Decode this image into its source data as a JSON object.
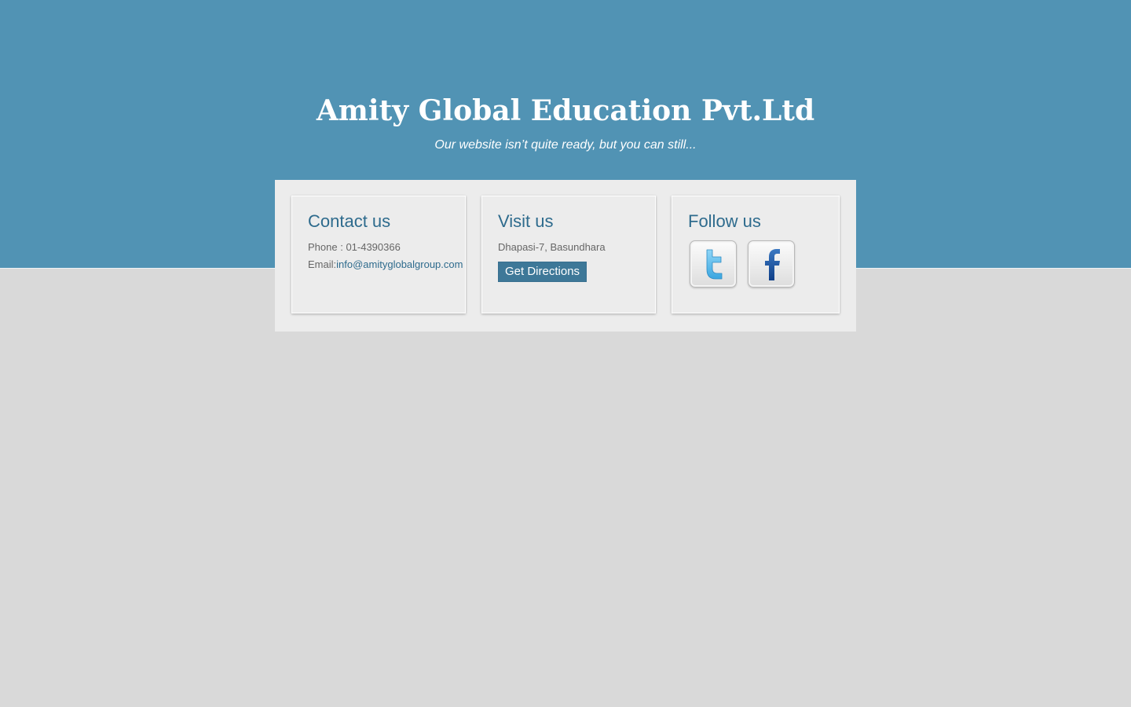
{
  "header": {
    "title": "Amity Global Education Pvt.Ltd",
    "tagline": "Our website isn’t quite ready, but you can still..."
  },
  "contact": {
    "heading": "Contact us",
    "phone_label": "Phone : ",
    "phone": "01-4390366",
    "email_label": "Email:",
    "email": "info@amityglobalgroup.com"
  },
  "visit": {
    "heading": "Visit us",
    "address": "Dhapasi-7, Basundhara",
    "directions_label": "Get Directions"
  },
  "follow": {
    "heading": "Follow us",
    "icons": [
      "twitter-icon",
      "facebook-icon"
    ]
  },
  "colors": {
    "header_background": "#5193b4",
    "page_background": "#d9d9d9",
    "panel_background": "#ececec",
    "heading_color": "#2e6b8d",
    "button_background": "#3e7898"
  }
}
